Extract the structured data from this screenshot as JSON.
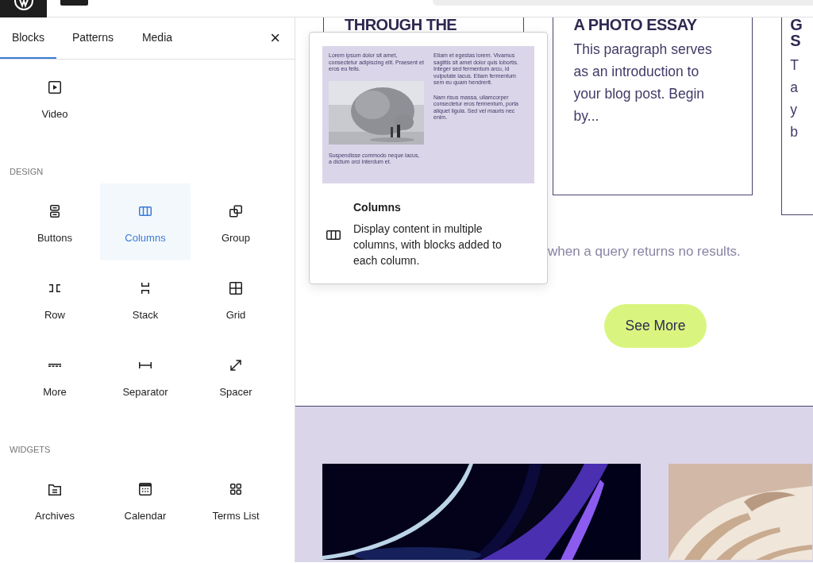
{
  "inserter": {
    "tabs": [
      {
        "label": "Blocks",
        "selected": true
      },
      {
        "label": "Patterns",
        "selected": false
      },
      {
        "label": "Media",
        "selected": false
      }
    ],
    "close": "×",
    "sections": [
      {
        "items": [
          {
            "label": "Video",
            "selected": false
          }
        ]
      },
      {
        "title": "DESIGN",
        "items": [
          {
            "label": "Buttons",
            "selected": false
          },
          {
            "label": "Columns",
            "selected": true
          },
          {
            "label": "Group",
            "selected": false
          },
          {
            "label": "Row",
            "selected": false
          },
          {
            "label": "Stack",
            "selected": false
          },
          {
            "label": "Grid",
            "selected": false
          },
          {
            "label": "More",
            "selected": false
          },
          {
            "label": "Separator",
            "selected": false
          },
          {
            "label": "Spacer",
            "selected": false
          }
        ]
      },
      {
        "title": "WIDGETS",
        "items": [
          {
            "label": "Archives",
            "selected": false
          },
          {
            "label": "Calendar",
            "selected": false
          },
          {
            "label": "Terms List",
            "selected": false
          }
        ]
      }
    ]
  },
  "preview": {
    "left": [
      "Lorem ipsum dolor sit amet, consectetur adipiscing elit. Praesent et eros eu felis.",
      "Suspendisse commodo neque lacus, a dictum orci interdum et."
    ],
    "right": [
      "Etiam et egestas lorem. Vivamus sagittis sit amet dolor quis lobortis. Integer sed fermentum arcu, id vulputate lacus. Etiam fermentum sem eu quam hendrerit.",
      "Nam risus massa, ullamcorper consectetur eros fermentum, porta aliquet ligula. Sed vel mauris nec enim."
    ],
    "title": "Columns",
    "description": "Display content in multiple columns, with blocks added to each column."
  },
  "cards": [
    {
      "heading": "THROUGH THE"
    },
    {
      "heading": "A PHOTO ESSAY",
      "paragraph": "This paragraph serves as an introduction to your blog post. Begin by..."
    },
    {
      "heading_lines": [
        "G",
        "S"
      ],
      "paragraph_lines": [
        "T",
        "a",
        "y",
        "b"
      ]
    }
  ],
  "no_results": "when a query returns no results.",
  "see_more": "See More"
}
